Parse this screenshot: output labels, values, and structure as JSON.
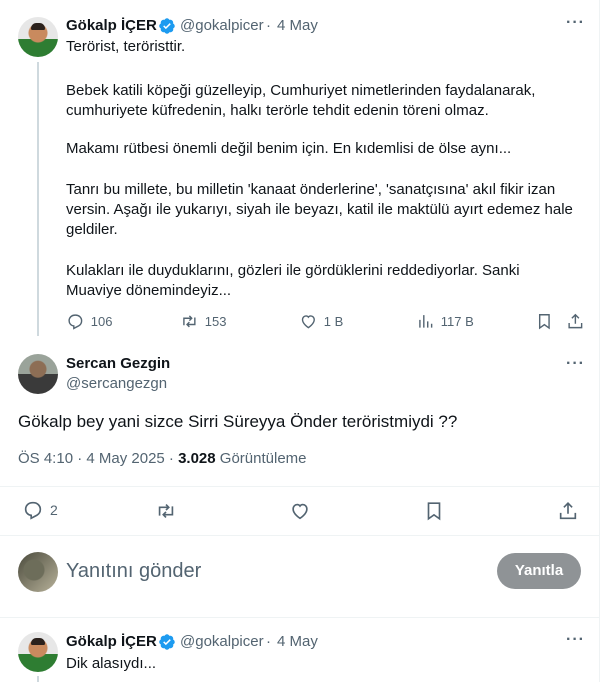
{
  "tweet1": {
    "name": "Gökalp İÇER",
    "handle": "@gokalpicer",
    "sep": "·",
    "date": "4 May",
    "lines": [
      "Terörist, teröristtir.",
      "Bebek katili köpeği güzelleyip, Cumhuriyet nimetlerinden faydalanarak,",
      "cumhuriyete küfredenin, halkı terörle tehdit edenin töreni olmaz.",
      "Makamı rütbesi önemli değil benim için. En kıdemlisi de ölse aynı...",
      "Tanrı bu millete, bu milletin 'kanaat önderlerine', 'sanatçısına' akıl fikir izan",
      "versin. Aşağı ile yukarıyı, siyah ile beyazı, katil ile maktülü ayırt edemez hale",
      "geldiler.",
      "Kulakları ile duyduklarını, gözleri ile gördüklerini reddediyorlar. Sanki",
      "Muaviye dönemindeyiz..."
    ],
    "replies": "106",
    "reposts": "153",
    "likes": "1 B",
    "views": "117 B"
  },
  "tweet2": {
    "name": "Sercan Gezgin",
    "handle": "@sercangezgn",
    "text": "Gökalp bey yani sizce Sirri Süreyya Önder teröristmiydi ??",
    "time": "ÖS 4:10 · 4 May 2025 · ",
    "views_count": "3.028",
    "views_label": " Görüntüleme",
    "replies": "2"
  },
  "composer": {
    "placeholder": "Yanıtını gönder",
    "button": "Yanıtla"
  },
  "tweet3": {
    "name": "Gökalp İÇER",
    "handle": "@gokalpicer",
    "sep": "·",
    "date": "4 May",
    "text": "Dik alasıydı..."
  },
  "colors": {
    "verified": "#1d9bf0",
    "muted": "#536471",
    "button_disabled": "#8f9396"
  },
  "icons": [
    "verified-badge-icon",
    "more-icon",
    "reply-icon",
    "repost-icon",
    "like-icon",
    "views-icon",
    "bookmark-icon",
    "share-icon"
  ]
}
